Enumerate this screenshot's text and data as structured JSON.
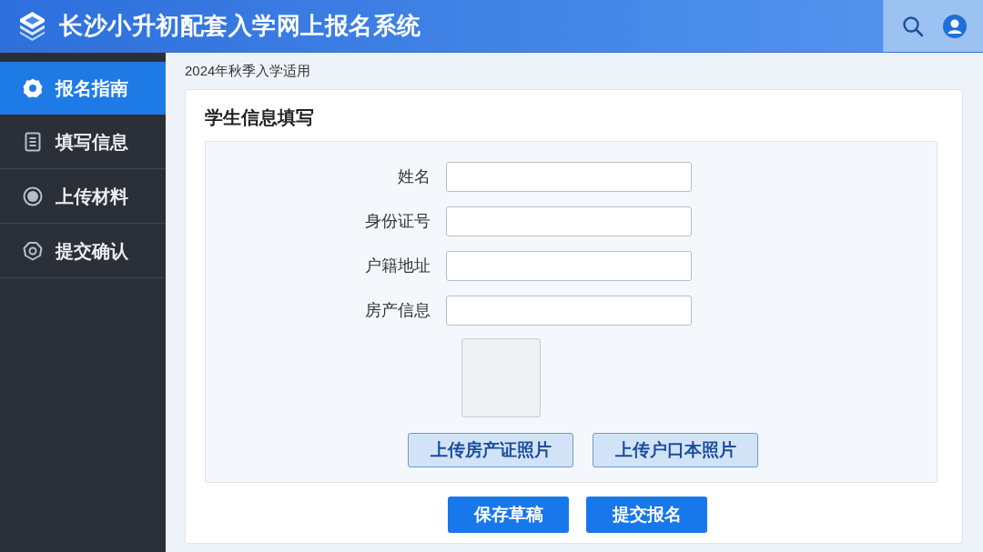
{
  "header": {
    "title": "长沙小升初配套入学网上报名系统"
  },
  "sidebar": {
    "items": [
      {
        "label": "报名指南",
        "selected": true
      },
      {
        "label": "填写信息",
        "selected": false
      },
      {
        "label": "上传材料",
        "selected": false
      },
      {
        "label": "提交确认",
        "selected": false
      }
    ]
  },
  "main": {
    "subtitle": "2024年秋季入学适用",
    "form": {
      "title": "学生信息填写",
      "fields": [
        {
          "label": "姓名"
        },
        {
          "label": "身份证号"
        },
        {
          "label": "户籍地址"
        },
        {
          "label": "房产信息"
        }
      ],
      "upload_buttons": [
        "上传房产证照片",
        "上传户口本照片"
      ]
    },
    "actions": [
      "保存草稿",
      "提交报名"
    ]
  }
}
